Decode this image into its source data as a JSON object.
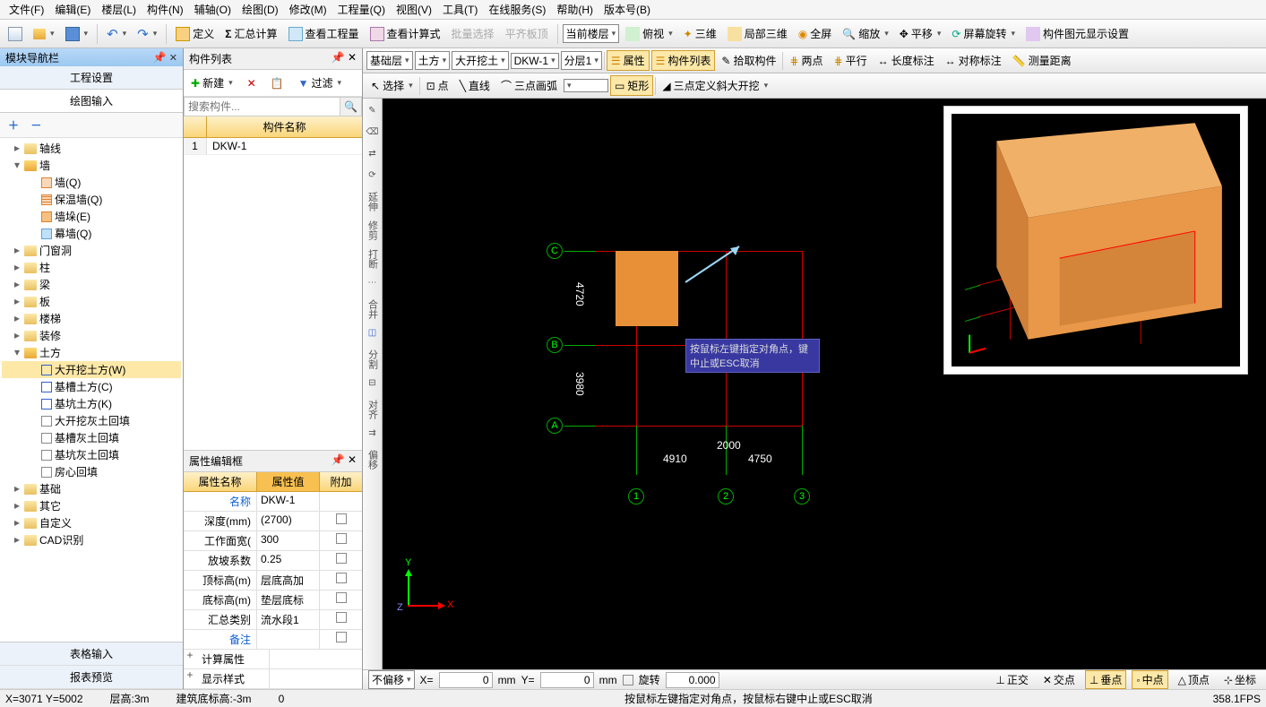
{
  "menu": [
    "文件(F)",
    "编辑(E)",
    "楼层(L)",
    "构件(N)",
    "辅轴(O)",
    "绘图(D)",
    "修改(M)",
    "工程量(Q)",
    "视图(V)",
    "工具(T)",
    "在线服务(S)",
    "帮助(H)",
    "版本号(B)"
  ],
  "toolbar1": {
    "define": "定义",
    "sumCalc": "汇总计算",
    "viewQty": "查看工程量",
    "viewFormula": "查看计算式",
    "batchSel": "批量选择",
    "alignTop": "平齐板顶",
    "currentFloor": "当前楼层",
    "topView": "俯视",
    "threeD": "三维",
    "localThreeD": "局部三维",
    "fullScreen": "全屏",
    "zoom": "缩放",
    "pan": "平移",
    "screenRotate": "屏幕旋转",
    "compDisplay": "构件图元显示设置"
  },
  "leftpanel": {
    "title": "模块导航栏",
    "tab1": "工程设置",
    "tab2": "绘图输入",
    "tree": {
      "axis": "轴线",
      "wall": "墙",
      "wallQ": "墙(Q)",
      "insulWall": "保温墙(Q)",
      "wallBrickE": "墙垛(E)",
      "curtainWall": "幕墙(Q)",
      "doorWindow": "门窗洞",
      "column": "柱",
      "beam": "梁",
      "slab": "板",
      "stair": "楼梯",
      "decor": "装修",
      "earth": "土方",
      "bigExcav": "大开挖土方(W)",
      "trenchEarth": "基槽土方(C)",
      "pitEarth": "基坑土方(K)",
      "bigExcavBackfill": "大开挖灰土回填",
      "trenchBackfill": "基槽灰土回填",
      "pitBackfill": "基坑灰土回填",
      "roomBackfill": "房心回填",
      "foundation": "基础",
      "other": "其它",
      "custom": "自定义",
      "cadRecog": "CAD识别"
    },
    "btab1": "表格输入",
    "btab2": "报表预览"
  },
  "complist": {
    "title": "构件列表",
    "new": "新建",
    "filter": "过滤",
    "searchPlaceholder": "搜索构件...",
    "colName": "构件名称",
    "row1": "DKW-1"
  },
  "proppanel": {
    "title": "属性编辑框",
    "colName": "属性名称",
    "colVal": "属性值",
    "colExtra": "附加",
    "rows": {
      "name_l": "名称",
      "name_v": "DKW-1",
      "depth_l": "深度(mm)",
      "depth_v": "(2700)",
      "workface_l": "工作面宽(",
      "workface_v": "300",
      "slope_l": "放坡系数",
      "slope_v": "0.25",
      "topelev_l": "顶标高(m)",
      "topelev_v": "层底高加",
      "botelev_l": "底标高(m)",
      "botelev_v": "垫层底标",
      "sumcat_l": "汇总类别",
      "sumcat_v": "流水段1",
      "remark_l": "备注",
      "calcprop": "计算属性",
      "dispstyle": "显示样式"
    }
  },
  "drawtoolbar": {
    "sel1": "基础层",
    "sel2": "土方",
    "sel3": "大开挖土",
    "sel4": "DKW-1",
    "sel5": "分层1",
    "prop": "属性",
    "compList": "构件列表",
    "pickComp": "拾取构件",
    "twoPoint": "两点",
    "parallel": "平行",
    "lenDim": "长度标注",
    "symDim": "对称标注",
    "measureDist": "测量距离"
  },
  "drawtoolbar2": {
    "select": "选择",
    "point": "点",
    "line": "直线",
    "arc3p": "三点画弧",
    "rect": "矩形",
    "slopeDef": "三点定义斜大开挖"
  },
  "sidetools": [
    "延伸",
    "修剪",
    "打断",
    "合并",
    "分割",
    "对齐",
    "偏移"
  ],
  "canvas": {
    "tooltip": "按鼠标左键指定对角点，键中止或ESC取消",
    "labels": {
      "A": "A",
      "B": "B",
      "C": "C",
      "n1": "1",
      "n2": "2",
      "n3": "3"
    },
    "dims": {
      "d1": "4720",
      "d2": "3980",
      "d3": "4910",
      "d4": "4750",
      "d5": "2000"
    }
  },
  "statusbar": {
    "noOffset": "不偏移",
    "xLabel": "X=",
    "xVal": "0",
    "mm1": "mm",
    "yLabel": "Y=",
    "yVal": "0",
    "mm2": "mm",
    "rotate": "旋转",
    "rotVal": "0.000",
    "ortho": "正交",
    "intersect": "交点",
    "vertex": "垂点",
    "midpoint": "中点",
    "apex": "顶点",
    "coord": "坐标"
  },
  "bottom": {
    "coord": "X=3071 Y=5002",
    "floorH": "层高:3m",
    "baseElev": "建筑底标高:-3m",
    "val0": "0",
    "hint": "按鼠标左键指定对角点，按鼠标右键中止或ESC取消",
    "fps": "358.1FPS"
  }
}
